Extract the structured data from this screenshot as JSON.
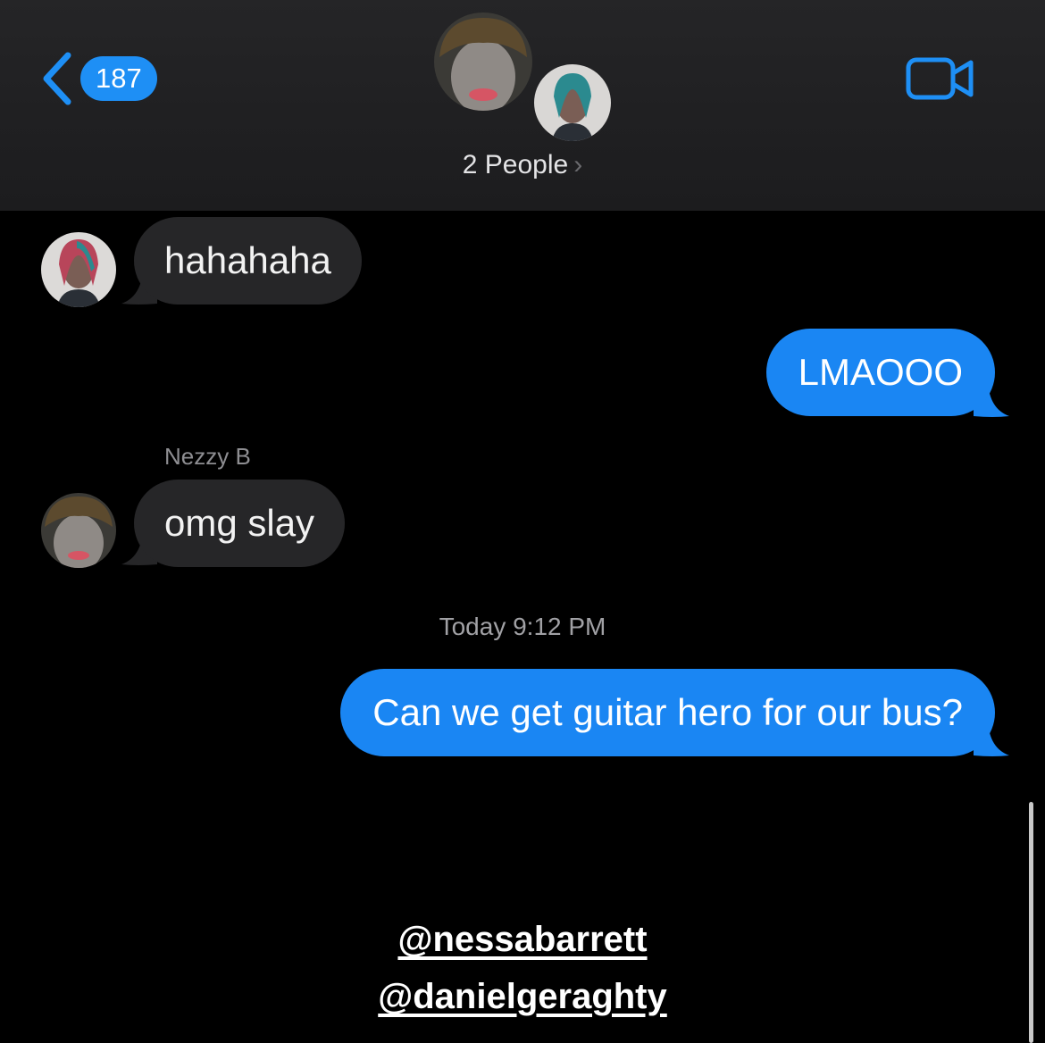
{
  "header": {
    "back_count": "187",
    "people_label": "2 People",
    "people_chevron": "›",
    "icons": {
      "back": "chevron-left-icon",
      "video": "video-camera-icon"
    }
  },
  "messages": [
    {
      "direction": "incoming",
      "sender": "",
      "text": "hahahaha"
    },
    {
      "direction": "outgoing",
      "text": "LMAOOO"
    },
    {
      "direction": "incoming",
      "sender": "Nezzy B",
      "text": "omg slay"
    },
    {
      "direction": "outgoing",
      "text": "Can we get guitar hero for our bus?"
    }
  ],
  "timestamp": "Today 9:12 PM",
  "mentions": [
    "@nessabarrett",
    "@danielgeraghty"
  ],
  "colors": {
    "accent": "#1e8ff5",
    "outgoing_bubble": "#1a86f3",
    "incoming_bubble": "#262628",
    "header_bg": "#1c1c1e",
    "background": "#000000"
  }
}
